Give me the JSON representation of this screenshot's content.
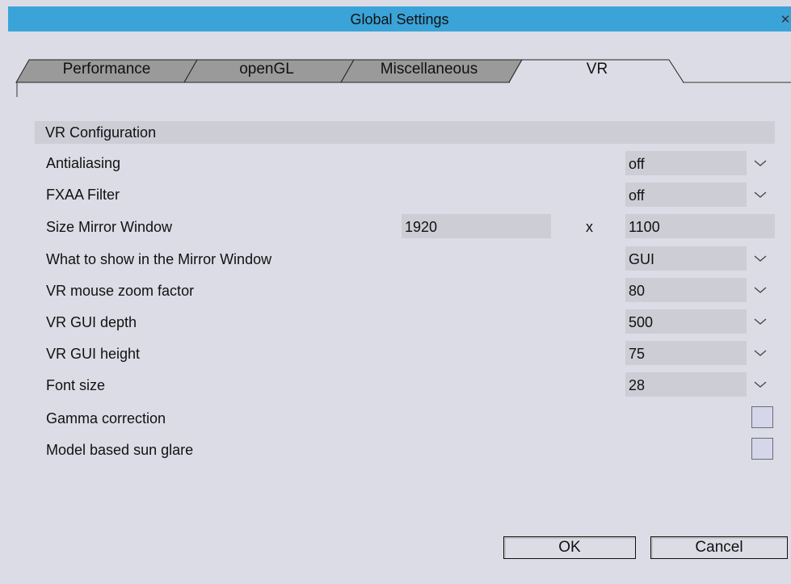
{
  "window": {
    "title": "Global Settings",
    "close_glyph": "✕"
  },
  "tabs": [
    {
      "label": "Performance",
      "active": false
    },
    {
      "label": "openGL",
      "active": false
    },
    {
      "label": "Miscellaneous",
      "active": false
    },
    {
      "label": "VR",
      "active": true
    }
  ],
  "section": {
    "title": "VR Configuration"
  },
  "settings": {
    "antialiasing": {
      "label": "Antialiasing",
      "value": "off"
    },
    "fxaa": {
      "label": "FXAA Filter",
      "value": "off"
    },
    "mirror_size": {
      "label": "Size Mirror Window",
      "width": "1920",
      "separator": "x",
      "height": "1100"
    },
    "mirror_show": {
      "label": "What to show in the Mirror Window",
      "value": "GUI"
    },
    "zoom": {
      "label": "VR mouse zoom factor",
      "value": "80"
    },
    "gui_depth": {
      "label": "VR GUI depth",
      "value": "500"
    },
    "gui_height": {
      "label": "VR GUI height",
      "value": "75"
    },
    "font_size": {
      "label": "Font size",
      "value": "28"
    },
    "gamma": {
      "label": "Gamma correction",
      "checked": false
    },
    "sun_glare": {
      "label": "Model based sun glare",
      "checked": false
    }
  },
  "buttons": {
    "ok": "OK",
    "cancel": "Cancel"
  },
  "colors": {
    "titlebar": "#3aa4d8",
    "background": "#dcdce6",
    "field": "#cdcdd6",
    "tab_inactive": "#9a9a9a"
  },
  "icons": {
    "dropdown": "chevron-down-icon",
    "close": "close-icon"
  }
}
